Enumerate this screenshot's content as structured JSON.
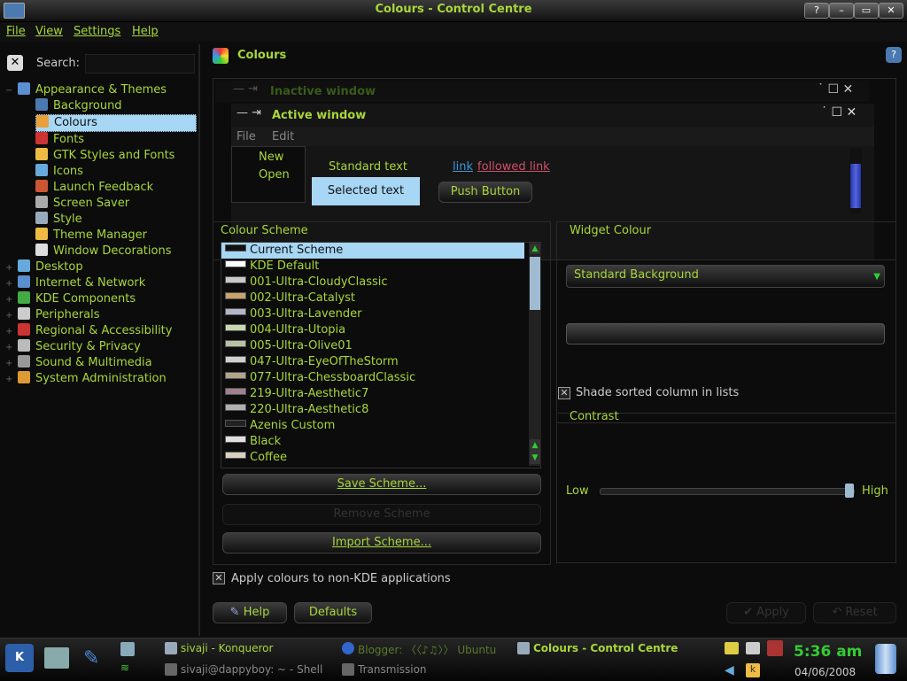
{
  "window": {
    "title": "Colours - Control Centre",
    "buttons": [
      "?",
      "–",
      "▭",
      "✕"
    ]
  },
  "menubar": [
    "File",
    "View",
    "Settings",
    "Help"
  ],
  "sidebar": {
    "search_label": "Search:",
    "search_value": "",
    "items": [
      {
        "label": "Appearance & Themes",
        "level": 0,
        "icon": "appearance-icon",
        "expanded": true
      },
      {
        "label": "Background",
        "level": 1,
        "icon": "background-icon"
      },
      {
        "label": "Colours",
        "level": 1,
        "icon": "colours-icon",
        "selected": true
      },
      {
        "label": "Fonts",
        "level": 1,
        "icon": "fonts-icon"
      },
      {
        "label": "GTK Styles and Fonts",
        "level": 1,
        "icon": "gtk-icon"
      },
      {
        "label": "Icons",
        "level": 1,
        "icon": "icons-icon"
      },
      {
        "label": "Launch Feedback",
        "level": 1,
        "icon": "launch-feedback-icon"
      },
      {
        "label": "Screen Saver",
        "level": 1,
        "icon": "screen-saver-icon"
      },
      {
        "label": "Style",
        "level": 1,
        "icon": "style-icon"
      },
      {
        "label": "Theme Manager",
        "level": 1,
        "icon": "theme-manager-icon"
      },
      {
        "label": "Window Decorations",
        "level": 1,
        "icon": "window-decorations-icon"
      },
      {
        "label": "Desktop",
        "level": 0,
        "icon": "desktop-icon"
      },
      {
        "label": "Internet & Network",
        "level": 0,
        "icon": "internet-icon"
      },
      {
        "label": "KDE Components",
        "level": 0,
        "icon": "kde-components-icon"
      },
      {
        "label": "Peripherals",
        "level": 0,
        "icon": "peripherals-icon"
      },
      {
        "label": "Regional & Accessibility",
        "level": 0,
        "icon": "regional-icon"
      },
      {
        "label": "Security & Privacy",
        "level": 0,
        "icon": "security-icon"
      },
      {
        "label": "Sound & Multimedia",
        "level": 0,
        "icon": "sound-icon"
      },
      {
        "label": "System Administration",
        "level": 0,
        "icon": "sysadmin-icon"
      }
    ]
  },
  "header": {
    "title": "Colours"
  },
  "preview": {
    "inactive_title": "Inactive window",
    "active_title": "Active window",
    "menu": [
      "File",
      "Edit"
    ],
    "menu_items": [
      "New",
      "Open"
    ],
    "standard_text": "Standard text",
    "selected_text": "Selected text",
    "link": "link",
    "followed_link": "followed link",
    "push_button": "Push Button"
  },
  "scheme": {
    "label": "Colour Scheme",
    "items": [
      {
        "name": "Current Scheme",
        "swatch": "#111111",
        "selected": true
      },
      {
        "name": "KDE Default",
        "swatch": "#ffffff"
      },
      {
        "name": "001-Ultra-CloudyClassic",
        "swatch": "#c9c9c9"
      },
      {
        "name": "002-Ultra-Catalyst",
        "swatch": "#c8a46a"
      },
      {
        "name": "003-Ultra-Lavender",
        "swatch": "#b5b5c8"
      },
      {
        "name": "004-Ultra-Utopia",
        "swatch": "#c8d8b0"
      },
      {
        "name": "005-Ultra-Olive01",
        "swatch": "#b8c2a2"
      },
      {
        "name": "047-Ultra-EyeOfTheStorm",
        "swatch": "#d0d0d0"
      },
      {
        "name": "077-Ultra-ChessboardClassic",
        "swatch": "#b0a48a"
      },
      {
        "name": "219-Ultra-Aesthetic7",
        "swatch": "#a08090"
      },
      {
        "name": "220-Ultra-Aesthetic8",
        "swatch": "#b0b0b0"
      },
      {
        "name": "Azenis Custom",
        "swatch": "#222222"
      },
      {
        "name": "Black",
        "swatch": "#e0e0e0"
      },
      {
        "name": "Coffee",
        "swatch": "#d8d0c0"
      }
    ],
    "save_label": "Save Scheme...",
    "remove_label": "Remove Scheme",
    "import_label": "Import Scheme..."
  },
  "widget": {
    "label": "Widget Colour",
    "selected": "Standard Background",
    "shade_label": "Shade sorted column in lists",
    "contrast_label": "Contrast",
    "low_label": "Low",
    "high_label": "High",
    "contrast_value": 1.0
  },
  "apply_label": "Apply colours to non-KDE applications",
  "bottom_buttons": {
    "help": "Help",
    "defaults": "Defaults",
    "apply": "Apply",
    "reset": "Reset"
  },
  "taskbar": {
    "tasks": [
      "sivaji - Konqueror",
      "Blogger: 〈〈♪♫〉〉 Ubuntu",
      "Colours - Control Centre",
      "sivaji@dappyboy: ~ - Shell",
      "Transmission"
    ],
    "time": "5:36 am",
    "date": "04/06/2008"
  },
  "colors": {
    "accent": "#a8d63a",
    "selection": "#a7d7f5",
    "background": "#0c0c0c"
  }
}
